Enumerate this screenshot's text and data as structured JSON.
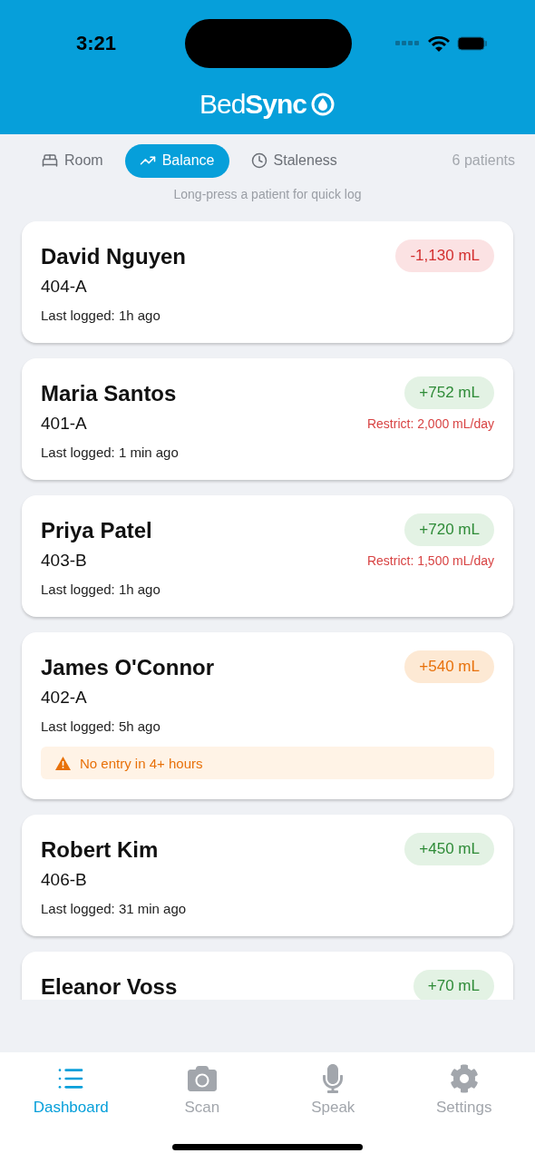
{
  "status_bar": {
    "time": "3:21"
  },
  "header": {
    "logo": "Bed**Sync**"
  },
  "sort_tabs": [
    {
      "label": "Room",
      "selected": false
    },
    {
      "label": "Balance",
      "selected": true
    },
    {
      "label": "Staleness",
      "selected": false
    }
  ],
  "patient_count": "6 patients",
  "hint": "Long-press a patient for quick log",
  "patients": [
    {
      "name": "David Nguyen",
      "room": "404-A",
      "last_logged": "Last logged: 1h ago",
      "balance": "-1,130 mL",
      "kind": "negative"
    },
    {
      "name": "Maria Santos",
      "room": "401-A",
      "last_logged": "Last logged: 1 min ago",
      "balance": "+752 mL",
      "kind": "positive",
      "restriction": "Restrict: 2,000 mL/day"
    },
    {
      "name": "Priya Patel",
      "room": "403-B",
      "last_logged": "Last logged: 1h ago",
      "balance": "+720 mL",
      "kind": "positive",
      "restriction": "Restrict: 1,500 mL/day"
    },
    {
      "name": "James O'Connor",
      "room": "402-A",
      "last_logged": "Last logged: 5h ago",
      "balance": "+540 mL",
      "kind": "caution",
      "alert": "No entry in 4+ hours"
    },
    {
      "name": "Robert Kim",
      "room": "406-B",
      "last_logged": "Last logged: 31 min ago",
      "balance": "+450 mL",
      "kind": "positive"
    },
    {
      "name": "Eleanor Voss",
      "balance": "+70 mL",
      "kind": "positive"
    }
  ],
  "nav": [
    {
      "label": "Dashboard",
      "selected": true
    },
    {
      "label": "Scan",
      "selected": false
    },
    {
      "label": "Speak",
      "selected": false
    },
    {
      "label": "Settings",
      "selected": false
    }
  ]
}
